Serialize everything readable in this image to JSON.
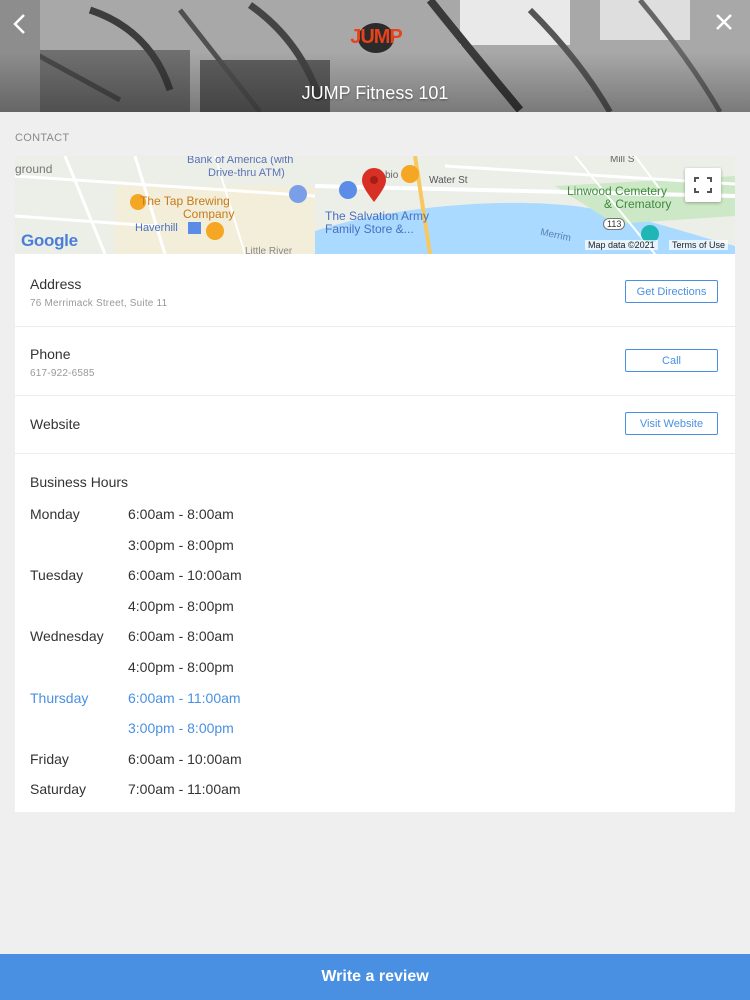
{
  "header": {
    "title": "JUMP Fitness 101",
    "logo_text": "JUMP",
    "back_icon": "chevron-left-icon",
    "close_icon": "close-icon"
  },
  "contact": {
    "section_label": "CONTACT",
    "map": {
      "labels": {
        "bank": "Bank of America (with",
        "bank2": "Drive-thru ATM)",
        "ground": "ground",
        "tap1": "The Tap Brewing",
        "tap2": "Company",
        "haverhill": "Haverhill",
        "salvation1": "The Salvation Army",
        "salvation2": "Family Store &...",
        "water_st": "Water St",
        "linwood1": "Linwood Cemetery",
        "linwood2": "& Crematory",
        "route": "113",
        "merrimack": "Merrim",
        "little_river": "Little River",
        "mill_st": "Mill S",
        "bio": "bio"
      },
      "google_logo": "Google",
      "map_data": "Map data ©2021",
      "terms": "Terms of Use"
    },
    "address": {
      "label": "Address",
      "value": "76 Merrimack Street, Suite 11",
      "button": "Get Directions"
    },
    "phone": {
      "label": "Phone",
      "value": "617-922-6585",
      "button": "Call"
    },
    "website": {
      "label": "Website",
      "button": "Visit Website"
    },
    "hours": {
      "title": "Business Hours",
      "lines": [
        {
          "day": "Monday",
          "time": "6:00am - 8:00am",
          "today": false
        },
        {
          "day": "",
          "time": "3:00pm - 8:00pm",
          "today": false
        },
        {
          "day": "Tuesday",
          "time": "6:00am - 10:00am",
          "today": false
        },
        {
          "day": "",
          "time": "4:00pm - 8:00pm",
          "today": false
        },
        {
          "day": "Wednesday",
          "time": "6:00am - 8:00am",
          "today": false
        },
        {
          "day": "",
          "time": "4:00pm - 8:00pm",
          "today": false
        },
        {
          "day": "Thursday",
          "time": "6:00am - 11:00am",
          "today": true
        },
        {
          "day": "",
          "time": "3:00pm - 8:00pm",
          "today": true
        },
        {
          "day": "Friday",
          "time": "6:00am - 10:00am",
          "today": false
        },
        {
          "day": "Saturday",
          "time": "7:00am - 11:00am",
          "today": false
        }
      ]
    }
  },
  "footer": {
    "review_button": "Write a review"
  },
  "colors": {
    "accent": "#4a90e2",
    "logo": "#e8421c",
    "map_marker": "#d93025"
  }
}
